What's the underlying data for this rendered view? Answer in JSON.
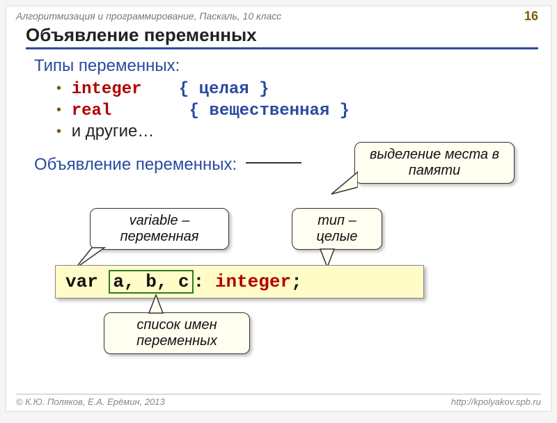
{
  "header": "Алгоритмизация и программирование, Паскаль, 10 класс",
  "page_number": "16",
  "title": "Объявление переменных",
  "section_types": "Типы переменных:",
  "types": {
    "integer_kw": "integer",
    "integer_comment": "{ целая }",
    "real_kw": "real",
    "real_comment": "{ вещественная }",
    "others": "и другие…"
  },
  "section_decl": "Объявление переменных:",
  "callouts": {
    "memory": "выделение места в памяти",
    "variable": "variable – переменная",
    "type": "тип – целые",
    "list": "список имен переменных"
  },
  "code": {
    "var": "var",
    "vars": "a, b, c",
    "colon": ":",
    "type": "integer",
    "semi": ";"
  },
  "footer_left": "© К.Ю. Поляков, Е.А. Ерёмин, 2013",
  "footer_right": "http://kpolyakov.spb.ru"
}
